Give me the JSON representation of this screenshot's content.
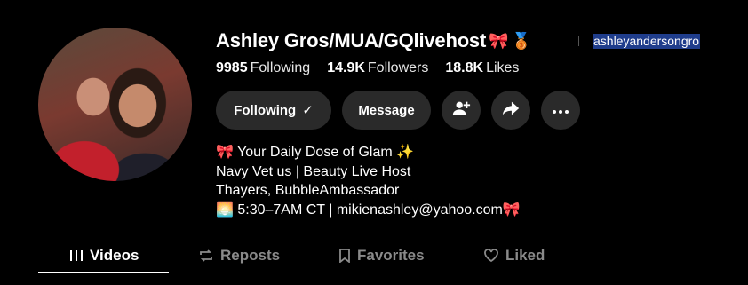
{
  "profile": {
    "display_name": "Ashley Gros/MUA/GQlivehost",
    "name_emojis": [
      "🎀",
      "🥉"
    ],
    "handle": "ashleyandersongro"
  },
  "stats": [
    {
      "value": "9985",
      "label": "Following"
    },
    {
      "value": "14.9K",
      "label": "Followers"
    },
    {
      "value": "18.8K",
      "label": "Likes"
    }
  ],
  "actions": {
    "following_label": "Following",
    "following_check": "✓",
    "message_label": "Message"
  },
  "bio": {
    "line1": "🎀 Your Daily Dose of Glam ✨",
    "line2": "Navy Vet us | Beauty Live Host",
    "line3": "Thayers, BubbleAmbassador",
    "line4": "🌅 5:30–7AM CT | mikienashley@yahoo.com🎀"
  },
  "tabs": [
    {
      "label": "Videos",
      "icon": "grid-icon",
      "active": true
    },
    {
      "label": "Reposts",
      "icon": "repost-icon",
      "active": false
    },
    {
      "label": "Favorites",
      "icon": "bookmark-icon",
      "active": false
    },
    {
      "label": "Liked",
      "icon": "heart-icon",
      "active": false
    }
  ],
  "colors": {
    "background": "#000000",
    "button_bg": "#2a2a2a",
    "handle_highlight": "#1f3d8c",
    "inactive_tab": "#8a8a8a"
  }
}
